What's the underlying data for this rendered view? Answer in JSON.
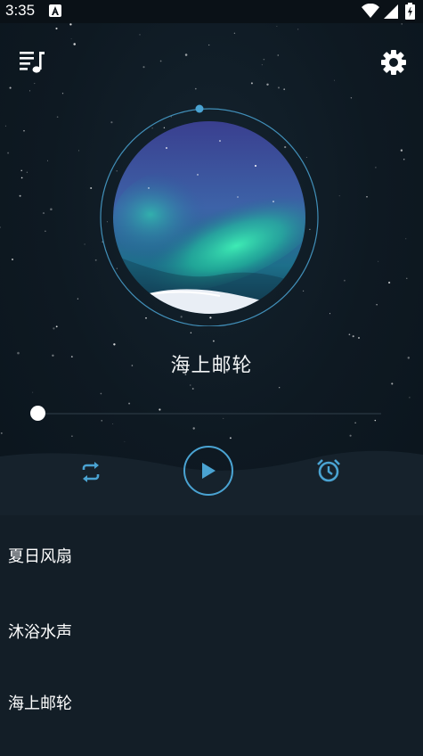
{
  "status_bar": {
    "time": "3:35",
    "icons": [
      "notification-a-icon",
      "wifi-icon",
      "signal-icon",
      "battery-icon"
    ]
  },
  "header": {
    "left_icon": "playlist-music-icon",
    "right_icon": "gear-icon"
  },
  "now_playing": {
    "title": "海上邮轮",
    "progress": 0.0
  },
  "controls": {
    "repeat_icon": "repeat-icon",
    "play_icon": "play-icon",
    "timer_icon": "alarm-clock-icon"
  },
  "tracks": [
    {
      "label": "夏日风扇"
    },
    {
      "label": "沐浴水声"
    },
    {
      "label": "海上邮轮"
    }
  ],
  "colors": {
    "background": "#0f1a22",
    "accent": "#4aa3d2",
    "list_background": "#131e27",
    "text": "#ffffff"
  }
}
